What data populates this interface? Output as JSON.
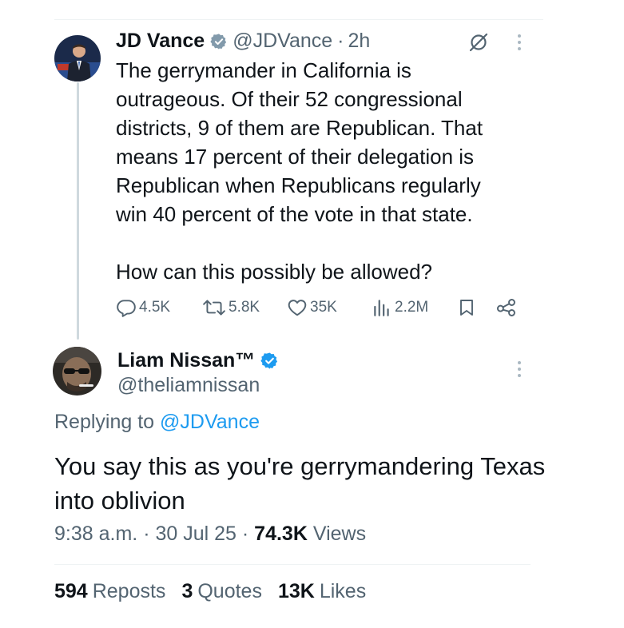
{
  "tweet": {
    "author_name": "JD Vance",
    "author_handle": "@JDVance",
    "separator": "·",
    "time": "2h",
    "text": "The gerrymander in California is\noutrageous. Of their 52 congressional\ndistricts, 9 of them are Republican. That\nmeans 17 percent of their delegation is\nRepublican when Republicans regularly\nwin 40 percent of the vote in that state.\n\nHow can this possibly be allowed?",
    "replies": "4.5K",
    "reposts": "5.8K",
    "likes": "35K",
    "views": "2.2M"
  },
  "reply": {
    "author_name": "Liam Nissan™",
    "author_handle": "@theliamnissan",
    "replying_prefix": "Replying to",
    "replying_to": "@JDVance",
    "text": "You say this as you're gerrymandering Texas into oblivion",
    "time": "9:38 a.m.",
    "separator1": "·",
    "date": "30 Jul 25",
    "separator2": "·",
    "views_count": "74.3K",
    "views_label": "Views",
    "reposts_count": "594",
    "reposts_label": "Reposts",
    "quotes_count": "3",
    "quotes_label": "Quotes",
    "likes_count": "13K",
    "likes_label": "Likes"
  },
  "colors": {
    "text_primary": "#0f1419",
    "text_secondary": "#536471",
    "accent": "#1d9bf0",
    "verified_gray": "#829aab",
    "thread_line": "#cfd9de"
  }
}
